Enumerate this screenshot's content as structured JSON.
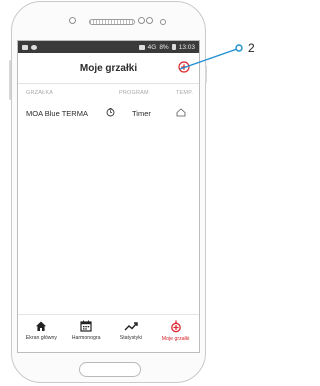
{
  "status_bar": {
    "time": "13:03",
    "signal": "4G",
    "battery": "8%"
  },
  "app_bar": {
    "title": "Moje grzałki",
    "add_icon": "plus-circle-icon"
  },
  "table": {
    "columns": [
      "GRZAŁKA",
      "PROGRAM",
      "TEMP."
    ],
    "rows": [
      {
        "name": "MOA Blue TERMA",
        "program_icon": "clock-icon",
        "program": "Timer",
        "temp_icon": "house-icon"
      }
    ]
  },
  "bottom_nav": {
    "items": [
      {
        "label": "Ekran główny",
        "icon": "home-icon",
        "active": false
      },
      {
        "label": "Harmonogra",
        "icon": "calendar-icon",
        "active": false
      },
      {
        "label": "Statystyki",
        "icon": "trend-icon",
        "active": false
      },
      {
        "label": "Moje grzałki",
        "icon": "heater-icon",
        "active": true
      }
    ]
  },
  "callout": {
    "number": "2"
  },
  "colors": {
    "accent": "#d9252c",
    "callout": "#1f8fd1"
  }
}
